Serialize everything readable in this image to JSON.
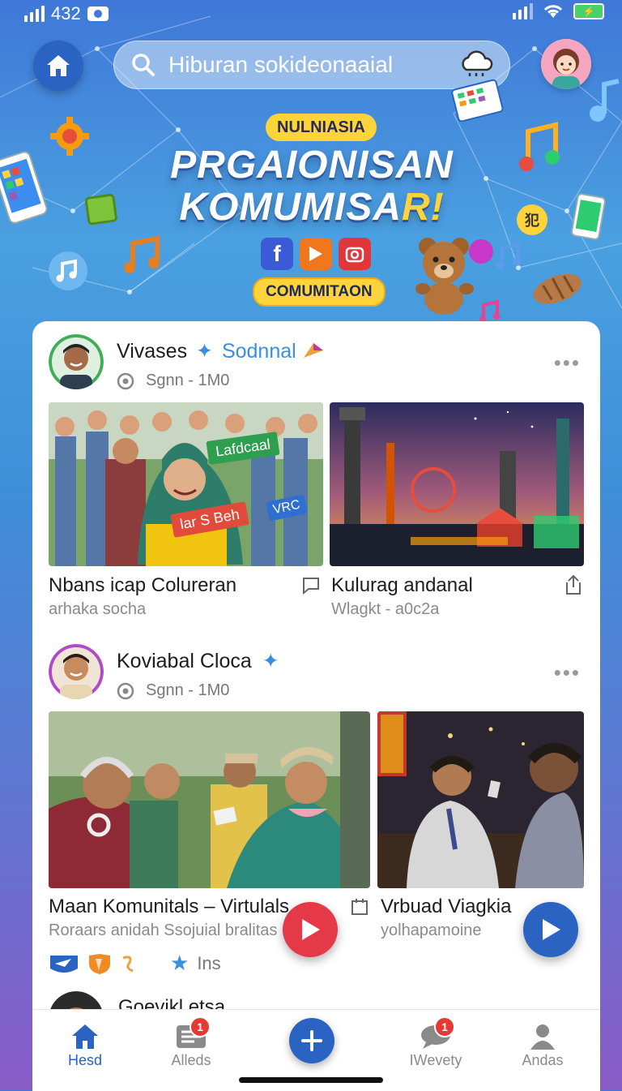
{
  "status_bar": {
    "time": "432"
  },
  "search": {
    "placeholder": "Hiburan sokideonaaial"
  },
  "hero": {
    "tag": "NULNIASIA",
    "title_line1": "PRGAIONISAN",
    "title_line2_main": "KOMUMISA",
    "title_line2_accent": "R!",
    "pill": "COMUMITAON",
    "sticker_text": "犯"
  },
  "posts": [
    {
      "author": "Vivases",
      "tag": "Sodnnal",
      "meta": "Sgnn - 1M0",
      "items": [
        {
          "title": "Nbans icap Colureran",
          "sub": "arhaka socha",
          "overlay_green": "Lafdcaal",
          "overlay_red": "lar S Beh",
          "overlay_blue": "VRC"
        },
        {
          "title": "Kulurag andanal",
          "sub": "Wlagkt - a0c2a"
        }
      ]
    },
    {
      "author": "Koviabal Cloca",
      "meta": "Sgnn - 1M0",
      "items": [
        {
          "title": "Maan Komunitals – Virtulals",
          "sub": "Roraars anidah Ssojuial bralitas O"
        },
        {
          "title": "Vrbuad Viagkia",
          "sub": "yolhapamoine"
        }
      ],
      "reaction_label": "Ins"
    },
    {
      "author": "Goevikl etsa"
    }
  ],
  "bottom_nav": [
    {
      "label": "Hesd",
      "icon": "home-icon",
      "active": true
    },
    {
      "label": "Alleds",
      "icon": "inbox-icon",
      "badge": "1"
    },
    {
      "label": "",
      "icon": "plus-icon"
    },
    {
      "label": "IWevety",
      "icon": "chat-icon",
      "badge": "1"
    },
    {
      "label": "Andas",
      "icon": "profile-icon"
    }
  ],
  "colors": {
    "accent": "#2a63c2",
    "tag_blue": "#3a8fe0",
    "badge_red": "#e53935",
    "hero_yellow": "#ffd43b"
  }
}
